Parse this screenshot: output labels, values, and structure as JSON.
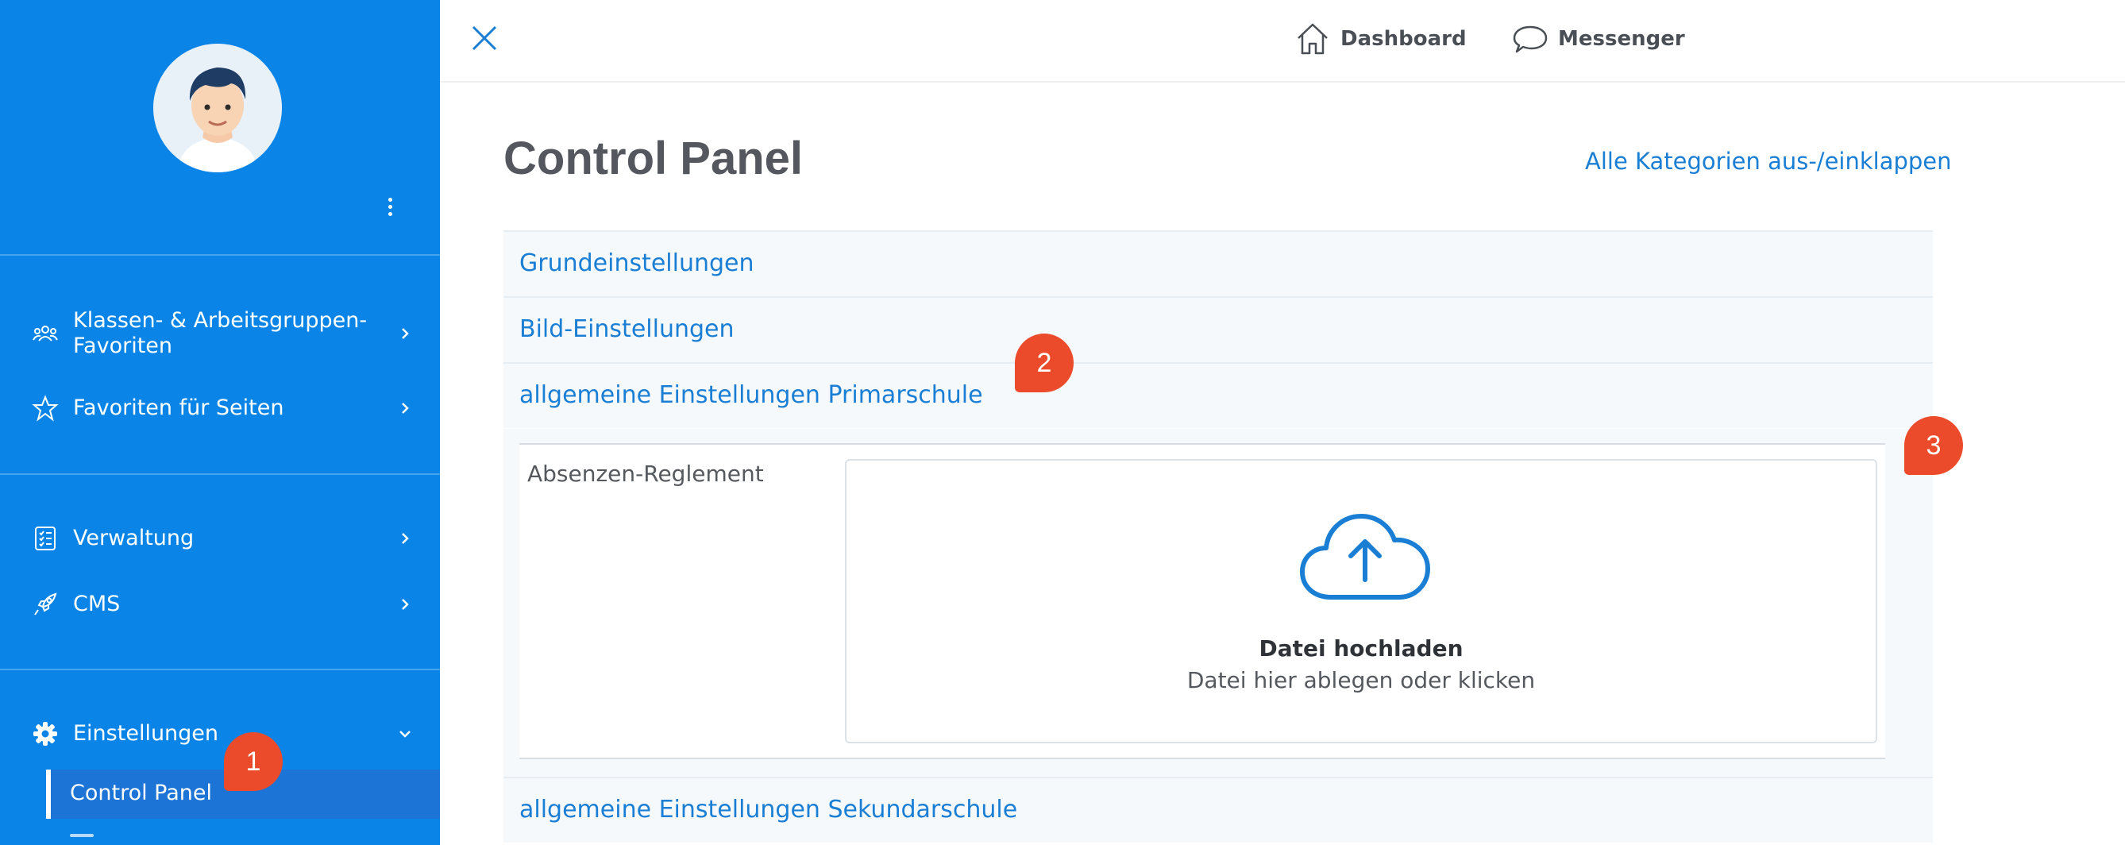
{
  "sidebar": {
    "groups": [
      {
        "label": "Klassen- & Arbeitsgruppen-\nFavoriten",
        "icon": "users-icon"
      },
      {
        "label": "Favoriten für Seiten",
        "icon": "star-icon"
      },
      {
        "label": "Verwaltung",
        "icon": "checklist-icon"
      },
      {
        "label": "CMS",
        "icon": "rocket-icon"
      },
      {
        "label": "Einstellungen",
        "icon": "gear-icon"
      }
    ],
    "active_sub_item": "Control Panel"
  },
  "badges": {
    "b1": "1",
    "b2": "2",
    "b3": "3"
  },
  "topbar": {
    "dashboard_label": "Dashboard",
    "messenger_label": "Messenger"
  },
  "main": {
    "title": "Control Panel",
    "toggle_all": "Alle Kategorien aus-/einklappen",
    "sections": [
      "Grundeinstellungen",
      "Bild-Einstellungen",
      "allgemeine Einstellungen Primarschule",
      "allgemeine Einstellungen Sekundarschule"
    ],
    "field_label": "Absenzen-Reglement",
    "upload_title": "Datei hochladen",
    "upload_hint": "Datei hier ablegen oder klicken"
  },
  "colors": {
    "sidebar_bg": "#0a84e6",
    "accent": "#1a7fd4",
    "badge": "#eb4b2a"
  }
}
